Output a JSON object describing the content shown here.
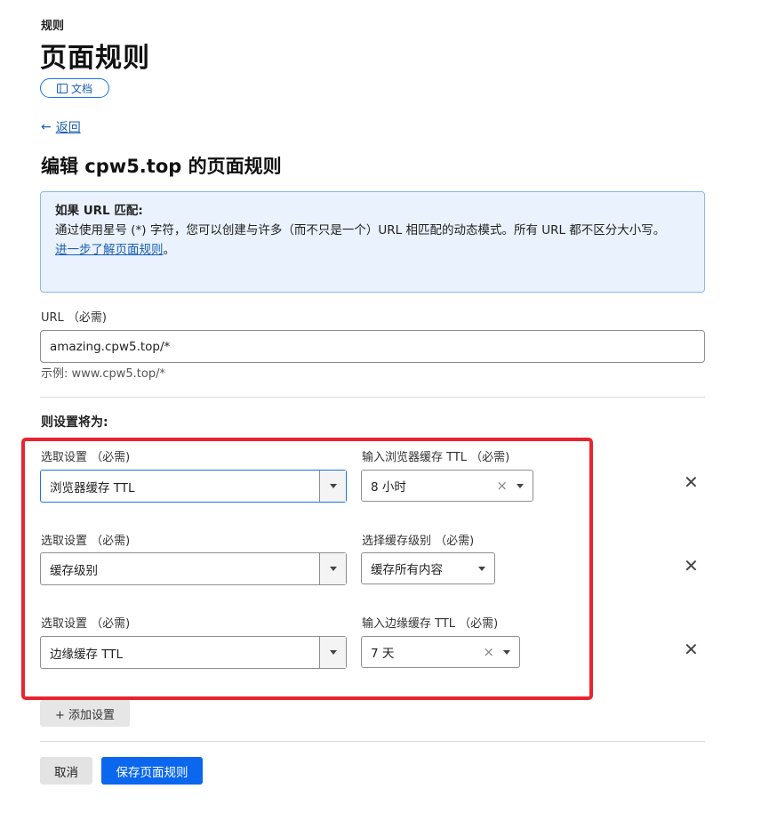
{
  "header": {
    "eyebrow": "规则",
    "title": "页面规则",
    "docs_label": "文档"
  },
  "nav": {
    "back_label": "返回"
  },
  "editor": {
    "heading": "编辑 cpw5.top 的页面规则"
  },
  "info": {
    "heading": "如果 URL 匹配:",
    "body": "通过使用星号 (*) 字符，您可以创建与许多（而不只是一个）URL 相匹配的动态模式。所有 URL 都不区分大小写。",
    "link": "进一步了解页面规则",
    "link_suffix": "。"
  },
  "url_field": {
    "label": "URL （必需)",
    "value": "amazing.cpw5.top/*",
    "hint": "示例:   www.cpw5.top/*"
  },
  "settings": {
    "heading": "则设置将为:",
    "rows": [
      {
        "setting_label": "选取设置 （必需)",
        "setting_value": "浏览器缓存 TTL",
        "value_label": "输入浏览器缓存 TTL （必需)",
        "value": "8 小时",
        "clearable": true
      },
      {
        "setting_label": "选取设置 （必需)",
        "setting_value": "缓存级别",
        "value_label": "选择缓存级别 （必需)",
        "value": "缓存所有内容",
        "clearable": false
      },
      {
        "setting_label": "选取设置 （必需)",
        "setting_value": "边缘缓存 TTL",
        "value_label": "输入边缘缓存 TTL （必需)",
        "value": "7 天",
        "clearable": true
      }
    ],
    "add_label": "+ 添加设置",
    "remove_glyph": "✕",
    "clear_glyph": "×"
  },
  "actions": {
    "cancel_label": "取消",
    "save_label": "保存页面规则"
  },
  "colors": {
    "accent": "#0a67ee",
    "link": "#1a5fb4",
    "highlight": "#e8242e",
    "info_bg": "#eaf2fd"
  }
}
